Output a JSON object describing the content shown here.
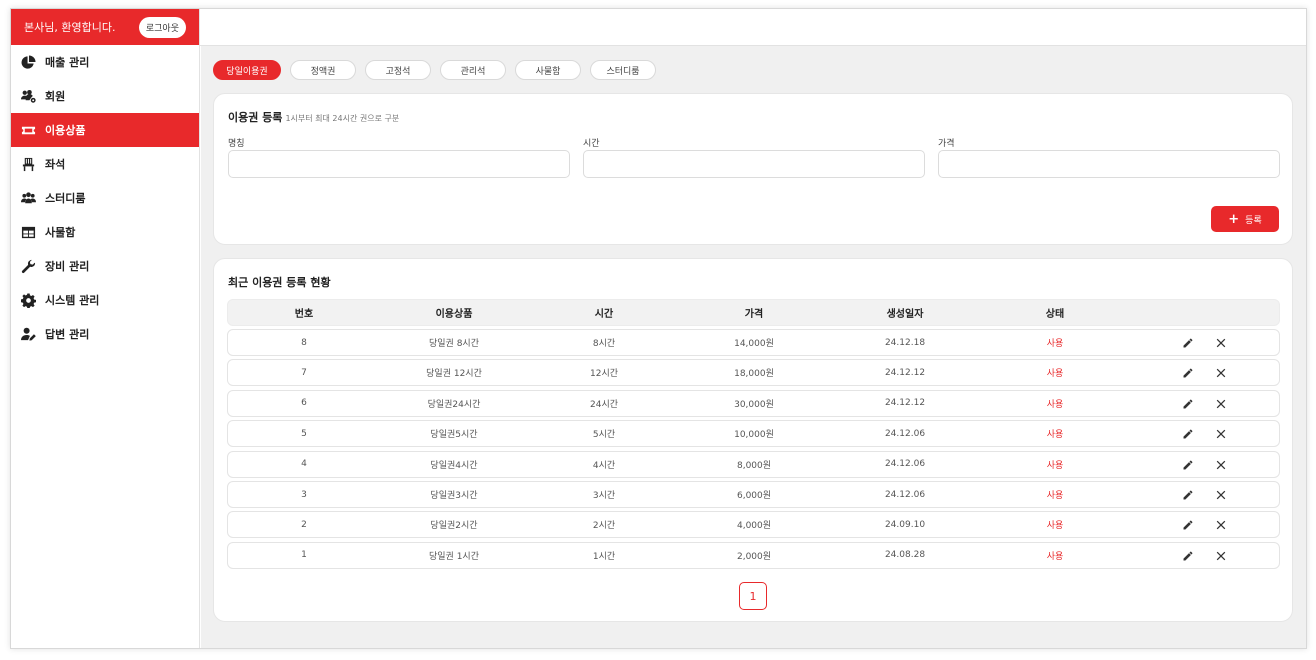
{
  "sidebar": {
    "welcome": "본사님, 환영합니다.",
    "logout_label": "로그아웃",
    "items": [
      {
        "label": "매출 관리",
        "icon": "pie-chart-icon"
      },
      {
        "label": "회원",
        "icon": "users-gear-icon"
      },
      {
        "label": "이용상품",
        "icon": "ticket-icon",
        "active": true
      },
      {
        "label": "좌석",
        "icon": "chair-icon"
      },
      {
        "label": "스터디룸",
        "icon": "group-icon"
      },
      {
        "label": "사물함",
        "icon": "locker-table-icon"
      },
      {
        "label": "장비 관리",
        "icon": "wrench-icon"
      },
      {
        "label": "시스템 관리",
        "icon": "gear-icon"
      },
      {
        "label": "답변 관리",
        "icon": "user-pen-icon"
      }
    ]
  },
  "tabs": [
    {
      "label": "당일이용권",
      "active": true
    },
    {
      "label": "정액권"
    },
    {
      "label": "고정석"
    },
    {
      "label": "관리석"
    },
    {
      "label": "사물함"
    },
    {
      "label": "스터디룸"
    }
  ],
  "register": {
    "title": "이용권 등록",
    "subtitle": "1시부터 최대 24시간 권으로 구분",
    "fields": [
      {
        "label": "명칭",
        "value": ""
      },
      {
        "label": "시간",
        "value": ""
      },
      {
        "label": "가격",
        "value": ""
      }
    ],
    "submit_label": "등록"
  },
  "list": {
    "title": "최근 이용권 등록 현황",
    "columns": [
      "번호",
      "이용상품",
      "시간",
      "가격",
      "생성일자",
      "상태"
    ],
    "rows": [
      [
        "8",
        "당일권 8시간",
        "8시간",
        "14,000원",
        "24.12.18",
        "사용"
      ],
      [
        "7",
        "당일권 12시간",
        "12시간",
        "18,000원",
        "24.12.12",
        "사용"
      ],
      [
        "6",
        "당일권24시간",
        "24시간",
        "30,000원",
        "24.12.12",
        "사용"
      ],
      [
        "5",
        "당일권5시간",
        "5시간",
        "10,000원",
        "24.12.06",
        "사용"
      ],
      [
        "4",
        "당일권4시간",
        "4시간",
        "8,000원",
        "24.12.06",
        "사용"
      ],
      [
        "3",
        "당일권3시간",
        "3시간",
        "6,000원",
        "24.12.06",
        "사용"
      ],
      [
        "2",
        "당일권2시간",
        "2시간",
        "4,000원",
        "24.09.10",
        "사용"
      ],
      [
        "1",
        "당일권 1시간",
        "1시간",
        "2,000원",
        "24.08.28",
        "사용"
      ]
    ],
    "page": "1"
  },
  "colors": {
    "accent": "#e8292b",
    "background": "#f0f0f0"
  }
}
